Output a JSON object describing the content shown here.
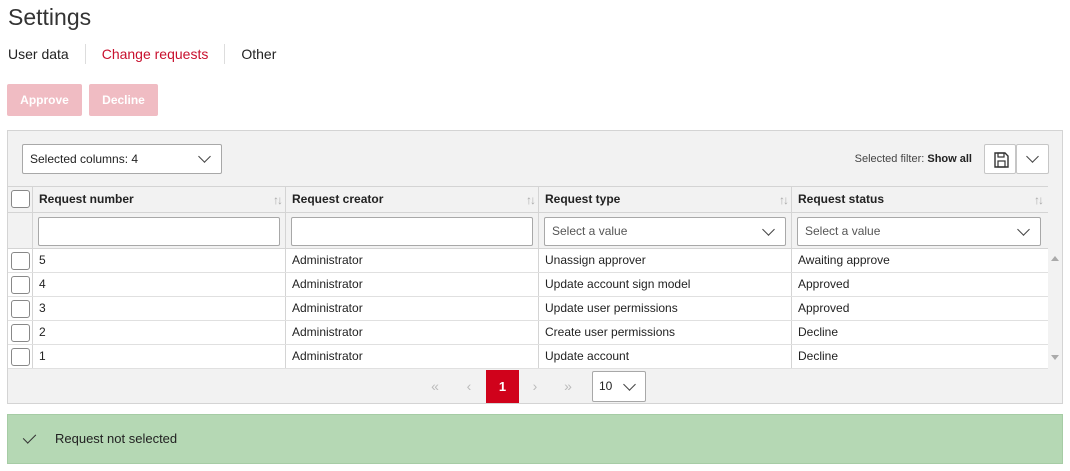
{
  "page_title": "Settings",
  "tabs": [
    {
      "label": "User data",
      "active": false
    },
    {
      "label": "Change requests",
      "active": true
    },
    {
      "label": "Other",
      "active": false
    }
  ],
  "actions": {
    "approve_label": "Approve",
    "decline_label": "Decline"
  },
  "toolbar": {
    "selected_columns": "Selected columns: 4",
    "filter_prefix": "Selected filter:",
    "filter_value": "Show all"
  },
  "table": {
    "columns": [
      "Request number",
      "Request creator",
      "Request type",
      "Request status"
    ],
    "filter_placeholders": {
      "type": "Select a value",
      "status": "Select a value"
    },
    "rows": [
      {
        "number": "5",
        "creator": "Administrator",
        "type": "Unassign approver",
        "status": "Awaiting approve"
      },
      {
        "number": "4",
        "creator": "Administrator",
        "type": "Update account sign model",
        "status": "Approved"
      },
      {
        "number": "3",
        "creator": "Administrator",
        "type": "Update user permissions",
        "status": "Approved"
      },
      {
        "number": "2",
        "creator": "Administrator",
        "type": "Create user permissions",
        "status": "Decline"
      },
      {
        "number": "1",
        "creator": "Administrator",
        "type": "Update account",
        "status": "Decline"
      }
    ]
  },
  "pagination": {
    "first": "«",
    "prev": "‹",
    "current": "1",
    "next": "›",
    "last": "»",
    "page_size": "10"
  },
  "notification": {
    "message": "Request not selected"
  },
  "colors": {
    "accent": "#c8102e",
    "active_page": "#d0021b",
    "disabled_button": "#f0bcc3",
    "success_bg": "#b5d8b4"
  }
}
